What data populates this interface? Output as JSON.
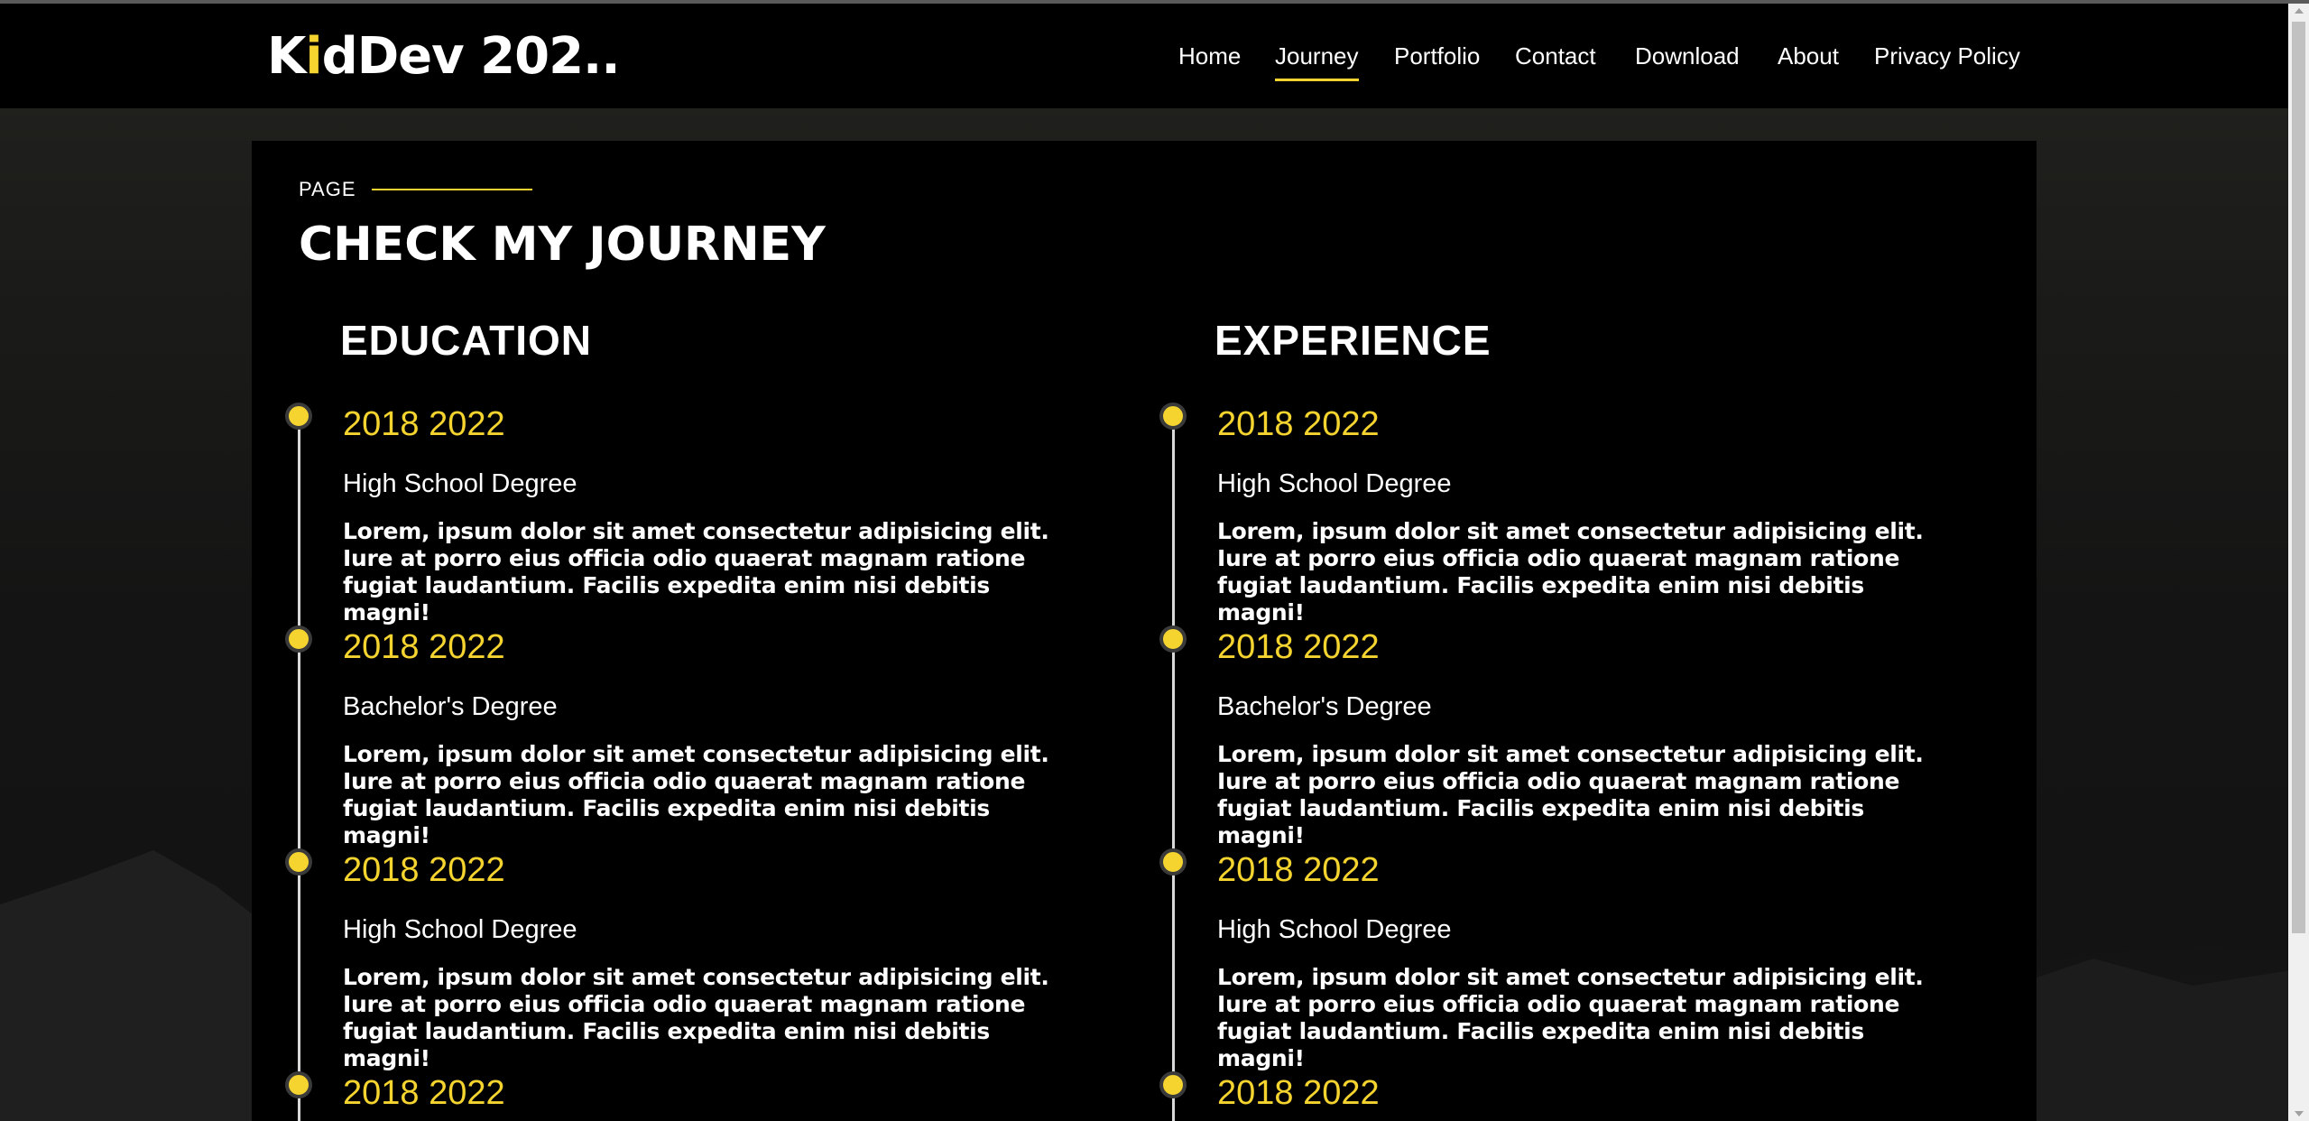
{
  "brand": {
    "logo_prefix": "K",
    "logo_i": "i",
    "logo_suffix": "dDev 202..",
    "accent_color": "#f5d430"
  },
  "nav": {
    "items": [
      {
        "label": "Home",
        "active": false
      },
      {
        "label": "Journey",
        "active": true
      },
      {
        "label": "Portfolio",
        "active": false
      },
      {
        "label": "Contact",
        "active": false
      },
      {
        "label": "Download",
        "active": false
      },
      {
        "label": "About",
        "active": false
      },
      {
        "label": "Privacy Policy",
        "active": false
      }
    ]
  },
  "page": {
    "eyebrow": "PAGE",
    "title": "CHECK MY JOURNEY"
  },
  "education": {
    "heading": "EDUCATION",
    "entries": [
      {
        "date": "2018 2022",
        "degree": "High School Degree",
        "desc": "Lorem, ipsum dolor sit amet consectetur adipisicing elit. Iure at porro eius officia odio quaerat magnam ratione fugiat laudantium. Facilis expedita enim nisi debitis magni!"
      },
      {
        "date": "2018 2022",
        "degree": "Bachelor's Degree",
        "desc": "Lorem, ipsum dolor sit amet consectetur adipisicing elit. Iure at porro eius officia odio quaerat magnam ratione fugiat laudantium. Facilis expedita enim nisi debitis magni!"
      },
      {
        "date": "2018 2022",
        "degree": "High School Degree",
        "desc": "Lorem, ipsum dolor sit amet consectetur adipisicing elit. Iure at porro eius officia odio quaerat magnam ratione fugiat laudantium. Facilis expedita enim nisi debitis magni!"
      },
      {
        "date": "2018 2022"
      }
    ]
  },
  "experience": {
    "heading": "EXPERIENCE",
    "entries": [
      {
        "date": "2018 2022",
        "degree": "High School Degree",
        "desc": "Lorem, ipsum dolor sit amet consectetur adipisicing elit. Iure at porro eius officia odio quaerat magnam ratione fugiat laudantium. Facilis expedita enim nisi debitis magni!"
      },
      {
        "date": "2018 2022",
        "degree": "Bachelor's Degree",
        "desc": "Lorem, ipsum dolor sit amet consectetur adipisicing elit. Iure at porro eius officia odio quaerat magnam ratione fugiat laudantium. Facilis expedita enim nisi debitis magni!"
      },
      {
        "date": "2018 2022",
        "degree": "High School Degree",
        "desc": "Lorem, ipsum dolor sit amet consectetur adipisicing elit. Iure at porro eius officia odio quaerat magnam ratione fugiat laudantium. Facilis expedita enim nisi debitis magni!"
      },
      {
        "date": "2018 2022"
      }
    ]
  }
}
